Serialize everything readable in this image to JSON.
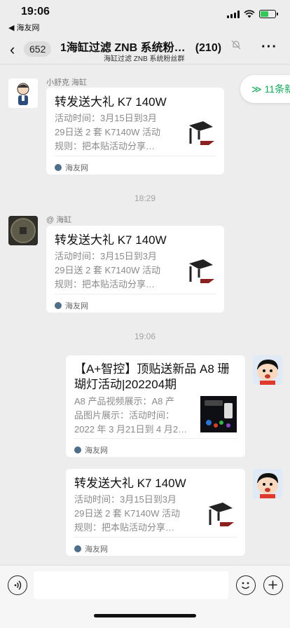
{
  "status_bar": {
    "time": "19:06",
    "back_app": "◀ 海友网",
    "battery_level": 0.55,
    "charging": true
  },
  "nav": {
    "back_count": "652",
    "title": "1海缸过滤 ZNB 系统粉…",
    "member_count": "(210)",
    "subtitle": "海缸过滤 ZNB 系统粉丝群",
    "muted": true
  },
  "new_messages": "≫ 11条新",
  "timestamps": [
    "18:29",
    "19:06"
  ],
  "messages": [
    {
      "sender": "小舒克 海缸",
      "title": "转发送大礼  K7 140W",
      "desc": "活动时间：3月15日到3月29日送 2 套 K7140W 活动规则：把本贴活动分享…",
      "desc_lines": [
        "活动时间：3月15日到3月",
        "29日送 2 套 K7140W 活动",
        "规则：把本贴活动分享…"
      ],
      "source": "海友网",
      "thumb": "k7-lamp"
    },
    {
      "sender": "@ 海缸",
      "title": "转发送大礼  K7 140W",
      "desc_lines": [
        "活动时间：3月15日到3月",
        "29日送 2 套 K7140W 活动",
        "规则：把本贴活动分享…"
      ],
      "source": "海友网",
      "thumb": "k7-lamp"
    },
    {
      "sender": "",
      "title_lines": [
        "【A+智控】顶贴送新品 A8 珊",
        "瑚灯活动|202204期"
      ],
      "desc_lines": [
        "A8 产品视频展示：A8 产",
        "品图片展示：活动时间：",
        "2022 年 3 月21日到 4 月2…"
      ],
      "source": "海友网",
      "thumb": "a8-lamp"
    },
    {
      "sender": "",
      "title": "转发送大礼  K7 140W",
      "desc_lines": [
        "活动时间：3月15日到3月",
        "29日送 2 套 K7140W 活动",
        "规则：把本贴活动分享…"
      ],
      "source": "海友网",
      "thumb": "k7-lamp"
    }
  ],
  "colors": {
    "background": "#ededed",
    "card": "#ffffff",
    "accent_green": "#16a85a"
  }
}
